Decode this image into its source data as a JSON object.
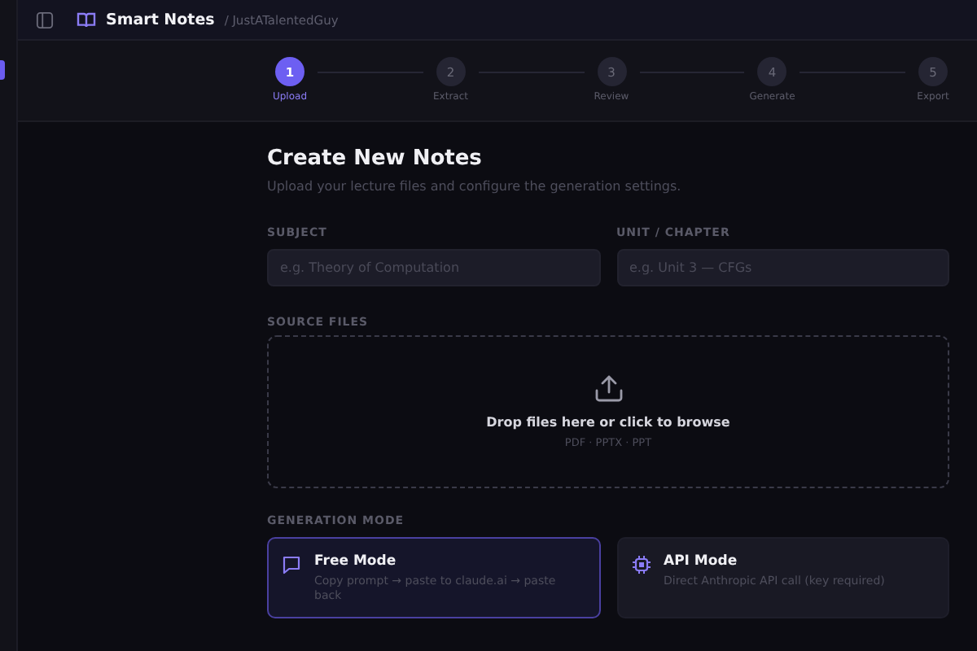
{
  "header": {
    "title": "Smart Notes",
    "breadcrumb": "/ JustATalentedGuy"
  },
  "steps": [
    {
      "number": "1",
      "label": "Upload",
      "selected": true
    },
    {
      "number": "2",
      "label": "Extract",
      "selected": false
    },
    {
      "number": "3",
      "label": "Review",
      "selected": false
    },
    {
      "number": "4",
      "label": "Generate",
      "selected": false
    },
    {
      "number": "5",
      "label": "Export",
      "selected": false
    }
  ],
  "page": {
    "title": "Create New Notes",
    "subtitle": "Upload your lecture files and configure the generation settings."
  },
  "fields": [
    {
      "label": "SUBJECT",
      "placeholder": "e.g. Theory of Computation"
    },
    {
      "label": "UNIT / CHAPTER",
      "placeholder": "e.g. Unit 3 — CFGs"
    }
  ],
  "source": {
    "label": "SOURCE FILES",
    "prompt": "Drop files here or click to browse",
    "formats": "PDF · PPTX · PPT"
  },
  "mode": {
    "label": "GENERATION MODE",
    "options": [
      {
        "kind": "chat",
        "title": "Free Mode",
        "description": "Copy prompt → paste to claude.ai → paste back",
        "selected": true
      },
      {
        "kind": "chip",
        "title": "API Mode",
        "description": "Direct Anthropic API call (key required)",
        "selected": false
      }
    ]
  }
}
